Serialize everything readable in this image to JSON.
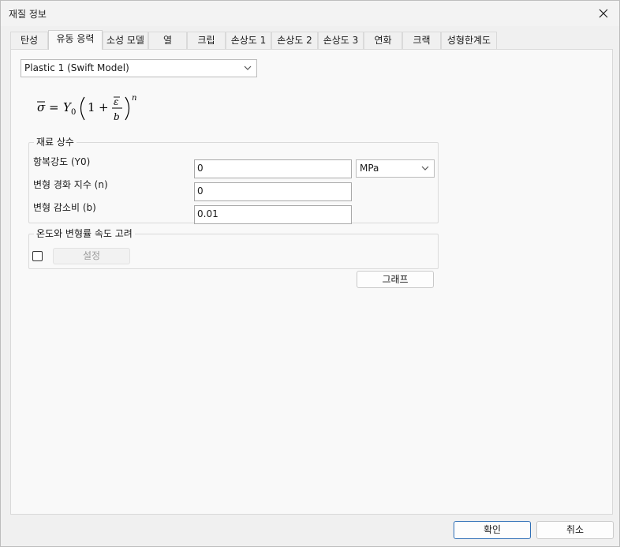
{
  "window": {
    "title": "재질 정보",
    "close_icon": "close-icon"
  },
  "tabs": [
    {
      "label": "탄성"
    },
    {
      "label": "유동 응력",
      "active": true
    },
    {
      "label": "소성 모델"
    },
    {
      "label": "열"
    },
    {
      "label": "크립"
    },
    {
      "label": "손상도 1"
    },
    {
      "label": "손상도 2"
    },
    {
      "label": "손상도 3"
    },
    {
      "label": "연화"
    },
    {
      "label": "크랙"
    },
    {
      "label": "성형한계도"
    }
  ],
  "model_select": {
    "value": "Plastic 1 (Swift Model)"
  },
  "formula": {
    "sigma": "σ",
    "eq": "=",
    "Y": "Y",
    "Y_sub": "0",
    "one": "1",
    "plus": "+",
    "eps": "ε",
    "b": "b",
    "n": "n"
  },
  "constants_group": {
    "title": "재료 상수",
    "rows": [
      {
        "label": "항복강도 (Y0)",
        "value": "0"
      },
      {
        "label": "변형 경화 지수 (n)",
        "value": "0"
      },
      {
        "label": "변형 감소비 (b)",
        "value": "0.01"
      }
    ],
    "unit": "MPa"
  },
  "temp_group": {
    "title": "온도와 변형률 속도 고려",
    "setting_label": "설정",
    "checked": false
  },
  "graph_button": "그래프",
  "footer": {
    "ok_label": "확인",
    "cancel_label": "취소"
  }
}
